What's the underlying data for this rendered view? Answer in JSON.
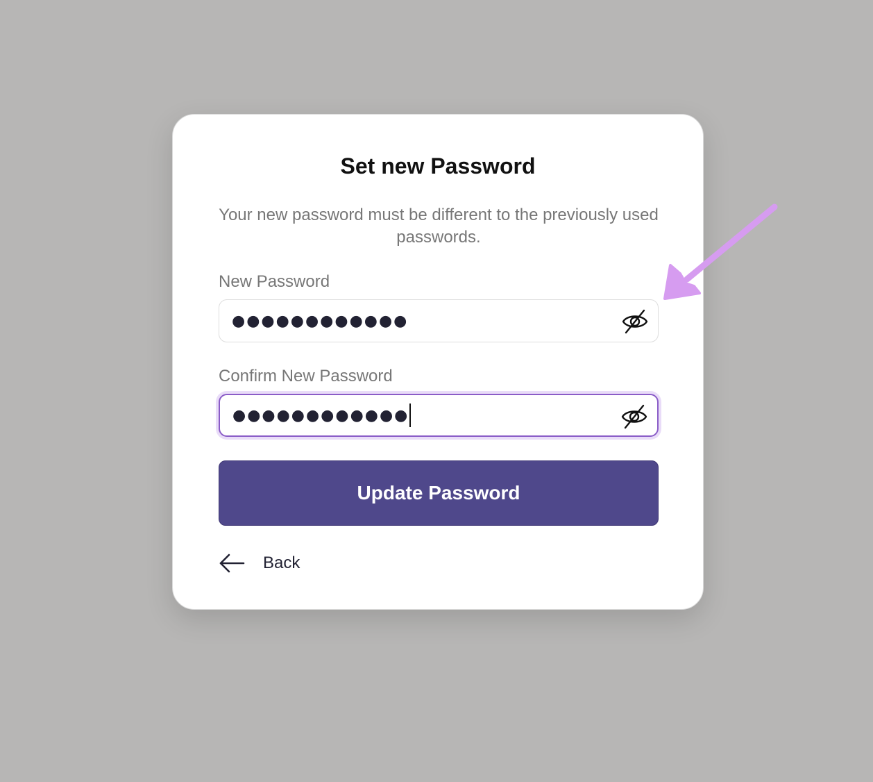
{
  "form": {
    "title": "Set new Password",
    "subtitle": "Your new password must be different to the previously used passwords.",
    "new_password": {
      "label": "New Password",
      "value": "●●●●●●●●●●●●",
      "toggle_icon": "eye-off-icon"
    },
    "confirm_password": {
      "label": "Confirm New Password",
      "value": "●●●●●●●●●●●●",
      "toggle_icon": "eye-off-icon",
      "focused": true
    },
    "submit_label": "Update Password",
    "back_label": "Back",
    "back_icon": "arrow-left-icon"
  },
  "colors": {
    "background": "#b7b6b5",
    "card": "#ffffff",
    "primary_button": "#4f488b",
    "focus_border": "#8a5cc7",
    "focus_ring": "#e9dcf8",
    "annotation_arrow": "#d69cf0",
    "muted_text": "#777777"
  },
  "annotation": {
    "icon": "annotation-arrow-icon"
  }
}
